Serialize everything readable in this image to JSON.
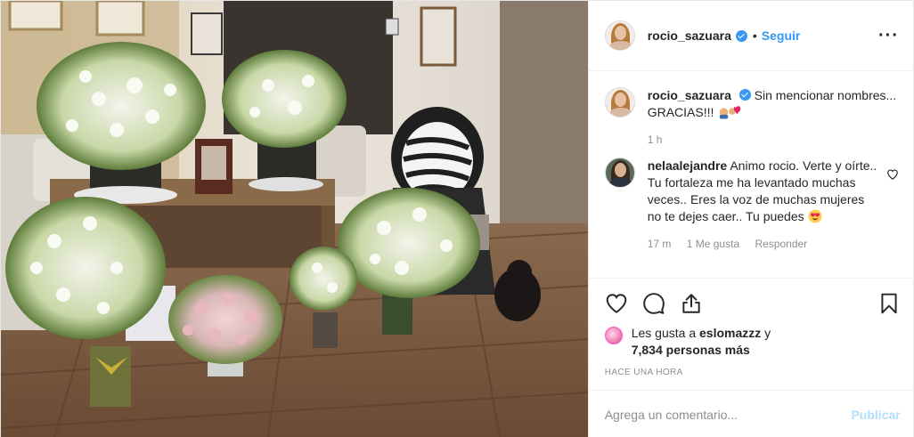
{
  "post": {
    "photo_alt": "",
    "author": {
      "username": "rocio_sazuara",
      "verified": true,
      "follow_label": "Seguir",
      "dot": "•",
      "more_label": "···"
    },
    "caption": {
      "username": "rocio_sazuara",
      "text": "Sin mencionar nombres... GRACIAS!!!",
      "time": "1 h"
    },
    "comments": [
      {
        "username": "nelaalejandre",
        "text": "Animo rocio. Verte y oírte.. Tu fortaleza me ha levantado muchas veces.. Eres la voz de muchas mujeres no te dejes caer.. Tu puedes",
        "time": "17 m",
        "likes": "1 Me gusta",
        "reply": "Responder"
      }
    ],
    "actions": {
      "like_icon": "heart-icon",
      "comment_icon": "comment-bubble-icon",
      "share_icon": "share-icon",
      "save_icon": "bookmark-icon"
    },
    "likes": {
      "prefix": "Les gusta a",
      "liker": "eslomazzz",
      "conj": "y",
      "count": "7,834 personas más"
    },
    "timestamp": "HACE UNA HORA",
    "add_comment": {
      "placeholder": "Agrega un comentario...",
      "publish_label": "Publicar"
    },
    "colors": {
      "accent": "#3897f0",
      "publish_disabled": "#b2dffc",
      "muted": "#8e8e8e",
      "text": "#262626",
      "border": "#efefef"
    }
  }
}
